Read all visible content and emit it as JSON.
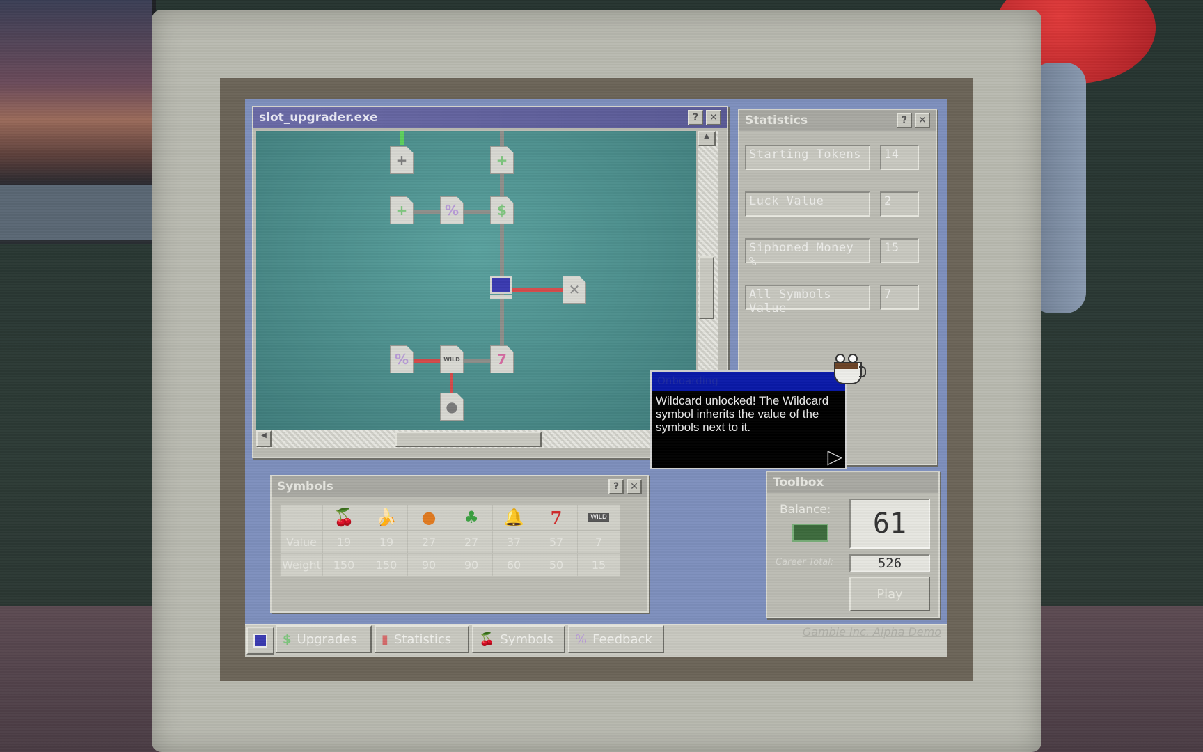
{
  "upgrader": {
    "title": "slot_upgrader.exe",
    "help_label": "?",
    "close_label": "✕"
  },
  "upgrade_nodes": [
    {
      "name": "upgrade-node-plus-top-left",
      "glyph": "+",
      "color": "#7a7a7a"
    },
    {
      "name": "upgrade-node-plus-top-right",
      "glyph": "+",
      "color": "#7cc47c"
    },
    {
      "name": "upgrade-node-plus-mid-left",
      "glyph": "+",
      "color": "#7cc47c"
    },
    {
      "name": "upgrade-node-percent-mid",
      "glyph": "%",
      "color": "#b79ad6"
    },
    {
      "name": "upgrade-node-dollar",
      "glyph": "$",
      "color": "#7cc47c"
    },
    {
      "name": "upgrade-node-locked-x",
      "glyph": "✕",
      "color": "#8a8a8a"
    },
    {
      "name": "upgrade-node-percent-bottom",
      "glyph": "%",
      "color": "#b79ad6"
    },
    {
      "name": "upgrade-node-wild",
      "glyph": "WILD",
      "color": "#555555"
    },
    {
      "name": "upgrade-node-seven",
      "glyph": "7",
      "color": "#d46aa0"
    },
    {
      "name": "upgrade-node-circle",
      "glyph": "●",
      "color": "#7a7a7a"
    }
  ],
  "statistics": {
    "title": "Statistics",
    "help_label": "?",
    "close_label": "✕",
    "rows": [
      {
        "label": "Starting Tokens",
        "value": "14"
      },
      {
        "label": "Luck Value",
        "value": "2"
      },
      {
        "label": "Siphoned Money %",
        "value": "15"
      },
      {
        "label": "All Symbols Value",
        "value": "7"
      }
    ]
  },
  "tooltip": {
    "title": "Onboarding",
    "message": "Wildcard unlocked! The Wildcard symbol inherits the value of the symbols next to it.",
    "next_icon": "▷"
  },
  "symbols": {
    "title": "Symbols",
    "help_label": "?",
    "close_label": "✕",
    "value_label": "Value",
    "weight_label": "Weight",
    "items": [
      {
        "icon": "cherry-icon",
        "glyph": "🍒",
        "value": "19",
        "weight": "150"
      },
      {
        "icon": "banana-icon",
        "glyph": "🍌",
        "value": "19",
        "weight": "150"
      },
      {
        "icon": "orange-icon",
        "glyph": "●",
        "value": "27",
        "weight": "90"
      },
      {
        "icon": "clover-icon",
        "glyph": "♣",
        "value": "27",
        "weight": "90"
      },
      {
        "icon": "bell-icon",
        "glyph": "🔔",
        "value": "37",
        "weight": "60"
      },
      {
        "icon": "seven-icon",
        "glyph": "7",
        "value": "57",
        "weight": "50"
      },
      {
        "icon": "wild-icon",
        "glyph": "WILD",
        "value": "7",
        "weight": "15"
      }
    ]
  },
  "toolbox": {
    "title": "Toolbox",
    "balance_label": "Balance:",
    "balance": "61",
    "career_label": "Career Total:",
    "career_total": "526",
    "play_label": "Play"
  },
  "taskbar": {
    "items": [
      {
        "name": "taskbar-upgrades",
        "label": "Upgrades",
        "icon": "dollar-file-icon",
        "glyph": "$"
      },
      {
        "name": "taskbar-statistics",
        "label": "Statistics",
        "icon": "bar-chart-icon",
        "glyph": "▮"
      },
      {
        "name": "taskbar-symbols",
        "label": "Symbols",
        "icon": "cherry-icon",
        "glyph": "🍒"
      },
      {
        "name": "taskbar-feedback",
        "label": "Feedback",
        "icon": "percent-file-icon",
        "glyph": "%"
      }
    ],
    "tray_text": "Gamble Inc. Alpha Demo"
  }
}
